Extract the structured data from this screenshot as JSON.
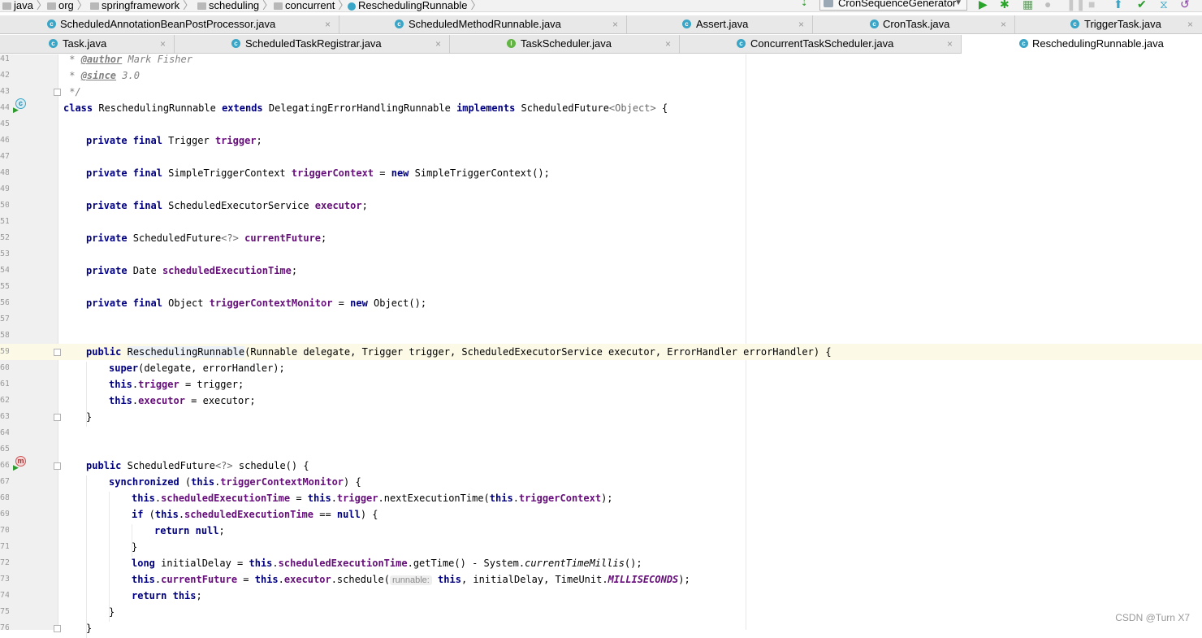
{
  "breadcrumb": [
    "java",
    "org",
    "springframework",
    "scheduling",
    "concurrent",
    "ReschedulingRunnable"
  ],
  "run_config": "CronSequenceGenerator",
  "tabs_row1": [
    {
      "label": "ScheduledAnnotationBeanPostProcessor.java",
      "icon": "class-icon"
    },
    {
      "label": "ScheduledMethodRunnable.java",
      "icon": "class-icon"
    },
    {
      "label": "Assert.java",
      "icon": "class-icon"
    },
    {
      "label": "CronTask.java",
      "icon": "class-icon"
    },
    {
      "label": "TriggerTask.java",
      "icon": "class-icon"
    }
  ],
  "tabs_row2": [
    {
      "label": "Task.java",
      "icon": "class-icon"
    },
    {
      "label": "ScheduledTaskRegistrar.java",
      "icon": "class-icon"
    },
    {
      "label": "TaskScheduler.java",
      "icon": "interface-icon"
    },
    {
      "label": "ConcurrentTaskScheduler.java",
      "icon": "class-icon"
    },
    {
      "label": "ReschedulingRunnable.java",
      "icon": "class-icon",
      "active": true
    }
  ],
  "editor": {
    "lines": [
      {
        "n": "41",
        "indent": 0,
        "tokens": [
          [
            " * ",
            "cmt"
          ],
          [
            "@author",
            "tag"
          ],
          [
            " Mark Fisher",
            "cmt"
          ]
        ]
      },
      {
        "n": "42",
        "indent": 0,
        "tokens": [
          [
            " * ",
            "cmt"
          ],
          [
            "@since",
            "tag"
          ],
          [
            " 3.0",
            "cmt"
          ]
        ]
      },
      {
        "n": "43",
        "indent": 0,
        "tokens": [
          [
            " */",
            "cmt"
          ]
        ]
      },
      {
        "n": "44",
        "indent": 0,
        "tokens": [
          [
            "class",
            "kw"
          ],
          [
            " ReschedulingRunnable ",
            ""
          ],
          [
            "extends",
            "kw"
          ],
          [
            " DelegatingErrorHandlingRunnable ",
            ""
          ],
          [
            "implements",
            "kw"
          ],
          [
            " ScheduledFuture",
            ""
          ],
          [
            "<Object>",
            "gen"
          ],
          [
            " {",
            ""
          ]
        ]
      },
      {
        "n": "45",
        "indent": 0,
        "tokens": []
      },
      {
        "n": "46",
        "indent": 1,
        "tokens": [
          [
            "private final",
            "kw"
          ],
          [
            " Trigger ",
            ""
          ],
          [
            "trigger",
            "fld"
          ],
          [
            ";",
            ""
          ]
        ]
      },
      {
        "n": "47",
        "indent": 0,
        "tokens": []
      },
      {
        "n": "48",
        "indent": 1,
        "tokens": [
          [
            "private final",
            "kw"
          ],
          [
            " SimpleTriggerContext ",
            ""
          ],
          [
            "triggerContext",
            "fld"
          ],
          [
            " = ",
            ""
          ],
          [
            "new",
            "kw"
          ],
          [
            " SimpleTriggerContext();",
            ""
          ]
        ]
      },
      {
        "n": "49",
        "indent": 0,
        "tokens": []
      },
      {
        "n": "50",
        "indent": 1,
        "tokens": [
          [
            "private final",
            "kw"
          ],
          [
            " ScheduledExecutorService ",
            ""
          ],
          [
            "executor",
            "fld"
          ],
          [
            ";",
            ""
          ]
        ]
      },
      {
        "n": "51",
        "indent": 0,
        "tokens": []
      },
      {
        "n": "52",
        "indent": 1,
        "tokens": [
          [
            "private",
            "kw"
          ],
          [
            " ScheduledFuture",
            ""
          ],
          [
            "<?>",
            "gen"
          ],
          [
            " ",
            ""
          ],
          [
            "currentFuture",
            "fld"
          ],
          [
            ";",
            ""
          ]
        ]
      },
      {
        "n": "53",
        "indent": 0,
        "tokens": []
      },
      {
        "n": "54",
        "indent": 1,
        "tokens": [
          [
            "private",
            "kw"
          ],
          [
            " Date ",
            ""
          ],
          [
            "scheduledExecutionTime",
            "fld"
          ],
          [
            ";",
            ""
          ]
        ]
      },
      {
        "n": "55",
        "indent": 0,
        "tokens": []
      },
      {
        "n": "56",
        "indent": 1,
        "tokens": [
          [
            "private final",
            "kw"
          ],
          [
            " Object ",
            ""
          ],
          [
            "triggerContextMonitor",
            "fld"
          ],
          [
            " = ",
            ""
          ],
          [
            "new",
            "kw"
          ],
          [
            " Object();",
            ""
          ]
        ]
      },
      {
        "n": "57",
        "indent": 0,
        "tokens": []
      },
      {
        "n": "58",
        "indent": 0,
        "tokens": []
      },
      {
        "n": "59",
        "indent": 1,
        "highlight": true,
        "tokens": [
          [
            "public",
            "kw"
          ],
          [
            " ",
            ""
          ],
          [
            "ReschedulingRunnable",
            "ctor"
          ],
          [
            "(Runnable delegate, Trigger trigger, ScheduledExecutorService executor, ErrorHandler errorHandler) {",
            ""
          ]
        ]
      },
      {
        "n": "60",
        "indent": 2,
        "tokens": [
          [
            "super",
            "kw"
          ],
          [
            "(delegate, errorHandler);",
            ""
          ]
        ]
      },
      {
        "n": "61",
        "indent": 2,
        "tokens": [
          [
            "this",
            "kw"
          ],
          [
            ".",
            ""
          ],
          [
            "trigger",
            "fld"
          ],
          [
            " = trigger;",
            ""
          ]
        ]
      },
      {
        "n": "62",
        "indent": 2,
        "tokens": [
          [
            "this",
            "kw"
          ],
          [
            ".",
            ""
          ],
          [
            "executor",
            "fld"
          ],
          [
            " = executor;",
            ""
          ]
        ]
      },
      {
        "n": "63",
        "indent": 1,
        "tokens": [
          [
            "}",
            ""
          ]
        ]
      },
      {
        "n": "64",
        "indent": 0,
        "tokens": []
      },
      {
        "n": "65",
        "indent": 0,
        "tokens": []
      },
      {
        "n": "66",
        "indent": 1,
        "tokens": [
          [
            "public",
            "kw"
          ],
          [
            " ScheduledFuture",
            ""
          ],
          [
            "<?>",
            "gen"
          ],
          [
            " schedule() {",
            ""
          ]
        ]
      },
      {
        "n": "67",
        "indent": 2,
        "tokens": [
          [
            "synchronized",
            "kw"
          ],
          [
            " (",
            ""
          ],
          [
            "this",
            "kw"
          ],
          [
            ".",
            ""
          ],
          [
            "triggerContextMonitor",
            "fld"
          ],
          [
            ") {",
            ""
          ]
        ]
      },
      {
        "n": "68",
        "indent": 3,
        "tokens": [
          [
            "this",
            "kw"
          ],
          [
            ".",
            ""
          ],
          [
            "scheduledExecutionTime",
            "fld"
          ],
          [
            " = ",
            ""
          ],
          [
            "this",
            "kw"
          ],
          [
            ".",
            ""
          ],
          [
            "trigger",
            "fld"
          ],
          [
            ".nextExecutionTime(",
            ""
          ],
          [
            "this",
            "kw"
          ],
          [
            ".",
            ""
          ],
          [
            "triggerContext",
            "fld"
          ],
          [
            ");",
            ""
          ]
        ]
      },
      {
        "n": "69",
        "indent": 3,
        "tokens": [
          [
            "if",
            "kw"
          ],
          [
            " (",
            ""
          ],
          [
            "this",
            "kw"
          ],
          [
            ".",
            ""
          ],
          [
            "scheduledExecutionTime",
            "fld"
          ],
          [
            " == ",
            ""
          ],
          [
            "null",
            "kw"
          ],
          [
            ") {",
            ""
          ]
        ]
      },
      {
        "n": "70",
        "indent": 4,
        "tokens": [
          [
            "return",
            "kw"
          ],
          [
            " ",
            ""
          ],
          [
            "null",
            "kw"
          ],
          [
            ";",
            ""
          ]
        ]
      },
      {
        "n": "71",
        "indent": 3,
        "tokens": [
          [
            "}",
            ""
          ]
        ]
      },
      {
        "n": "72",
        "indent": 3,
        "tokens": [
          [
            "long",
            "kw"
          ],
          [
            " initialDelay = ",
            ""
          ],
          [
            "this",
            "kw"
          ],
          [
            ".",
            ""
          ],
          [
            "scheduledExecutionTime",
            "fld"
          ],
          [
            ".getTime() - System.",
            ""
          ],
          [
            "currentTimeMillis",
            "itl"
          ],
          [
            "();",
            ""
          ]
        ]
      },
      {
        "n": "73",
        "indent": 3,
        "tokens": [
          [
            "this",
            "kw"
          ],
          [
            ".",
            ""
          ],
          [
            "currentFuture",
            "fld"
          ],
          [
            " = ",
            ""
          ],
          [
            "this",
            "kw"
          ],
          [
            ".",
            ""
          ],
          [
            "executor",
            "fld"
          ],
          [
            ".schedule(",
            ""
          ],
          [
            "runnable:",
            "hint"
          ],
          [
            " ",
            ""
          ],
          [
            "this",
            "kw"
          ],
          [
            ", initialDelay, TimeUnit.",
            ""
          ],
          [
            "MILLISECONDS",
            "st"
          ],
          [
            ");",
            ""
          ]
        ]
      },
      {
        "n": "74",
        "indent": 3,
        "tokens": [
          [
            "return",
            "kw"
          ],
          [
            " ",
            ""
          ],
          [
            "this",
            "kw"
          ],
          [
            ";",
            ""
          ]
        ]
      },
      {
        "n": "75",
        "indent": 2,
        "tokens": [
          [
            "}",
            ""
          ]
        ]
      },
      {
        "n": "76",
        "indent": 1,
        "tokens": [
          [
            "}",
            ""
          ]
        ]
      }
    ]
  },
  "watermark": "CSDN @Turn X7"
}
